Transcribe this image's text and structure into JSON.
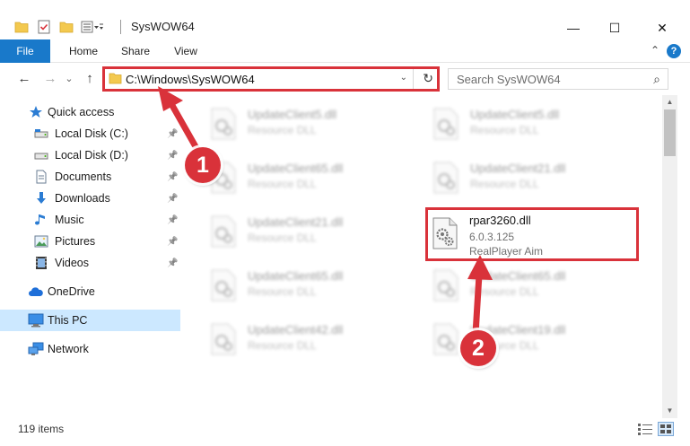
{
  "window": {
    "title": "SysWOW64",
    "minimize_glyph": "—",
    "maximize_glyph": "☐",
    "close_glyph": "✕"
  },
  "ribbon": {
    "tabs": [
      "File",
      "Home",
      "Share",
      "View"
    ],
    "help_glyph": "?",
    "collapse_glyph": "⌃"
  },
  "nav": {
    "back_glyph": "←",
    "forward_glyph": "→",
    "recent_glyph": "⌄",
    "up_glyph": "↑",
    "address": "C:\\Windows\\SysWOW64",
    "address_dropdown_glyph": "⌄",
    "refresh_glyph": "↻",
    "search_placeholder": "Search SysWOW64",
    "search_icon_glyph": "⌕"
  },
  "sidebar": {
    "quick_access": "Quick access",
    "items": [
      {
        "label": "Local Disk (C:)",
        "icon": "drive-icon",
        "pinned": true
      },
      {
        "label": "Local Disk (D:)",
        "icon": "drive-icon",
        "pinned": true
      },
      {
        "label": "Documents",
        "icon": "documents-icon",
        "pinned": true
      },
      {
        "label": "Downloads",
        "icon": "downloads-icon",
        "pinned": true
      },
      {
        "label": "Music",
        "icon": "music-icon",
        "pinned": true
      },
      {
        "label": "Pictures",
        "icon": "pictures-icon",
        "pinned": true
      },
      {
        "label": "Videos",
        "icon": "videos-icon",
        "pinned": true
      }
    ],
    "pin_glyph": "📌",
    "onedrive": "OneDrive",
    "this_pc": "This PC",
    "network": "Network"
  },
  "files": [
    {
      "name": "UpdateClient5.dll",
      "desc1": "Resource DLL",
      "desc2": ""
    },
    {
      "name": "UpdateClient5.dll",
      "desc1": "Resource DLL",
      "desc2": ""
    },
    {
      "name": "UpdateClient65.dll",
      "desc1": "Resource DLL",
      "desc2": ""
    },
    {
      "name": "UpdateClient21.dll",
      "desc1": "Resource DLL",
      "desc2": ""
    },
    {
      "name": "UpdateClient21.dll",
      "desc1": "Resource DLL",
      "desc2": ""
    },
    {
      "name": "rpar3260.dll",
      "desc1": "6.0.3.125",
      "desc2": "RealPlayer Aim"
    },
    {
      "name": "UpdateClient65.dll",
      "desc1": "Resource DLL",
      "desc2": ""
    },
    {
      "name": "UpdateClient65.dll",
      "desc1": "Resource DLL",
      "desc2": ""
    },
    {
      "name": "UpdateClient42.dll",
      "desc1": "Resource DLL",
      "desc2": ""
    },
    {
      "name": "UpdateClient19.dll",
      "desc1": "Resource DLL",
      "desc2": ""
    }
  ],
  "status": {
    "item_count": "119 items"
  },
  "annotations": {
    "step1": "1",
    "step2": "2",
    "highlight_color": "#d9323a"
  }
}
